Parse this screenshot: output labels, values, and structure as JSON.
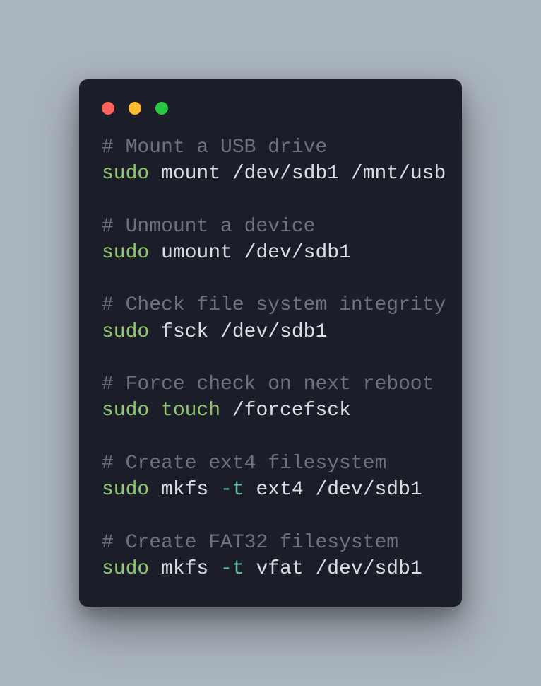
{
  "window": {
    "close_icon": "close",
    "minimize_icon": "minimize",
    "maximize_icon": "maximize"
  },
  "code": {
    "l1_comment": "# Mount a USB drive",
    "l2_sudo": "sudo",
    "l2_rest": " mount /dev/sdb1 /mnt/usb",
    "l3_comment": "# Unmount a device",
    "l4_sudo": "sudo",
    "l4_rest": " umount /dev/sdb1",
    "l5_comment": "# Check file system integrity",
    "l6_sudo": "sudo",
    "l6_rest": " fsck /dev/sdb1",
    "l7_comment": "# Force check on next reboot",
    "l8_sudo": "sudo",
    "l8_touch": " touch",
    "l8_rest": " /forcefsck",
    "l9_comment": "# Create ext4 filesystem",
    "l10_sudo": "sudo",
    "l10_mkfs": " mkfs ",
    "l10_flag": "-t",
    "l10_rest": " ext4 /dev/sdb1",
    "l11_comment": "# Create FAT32 filesystem",
    "l12_sudo": "sudo",
    "l12_mkfs": " mkfs ",
    "l12_flag": "-t",
    "l12_rest": " vfat /dev/sdb1"
  }
}
